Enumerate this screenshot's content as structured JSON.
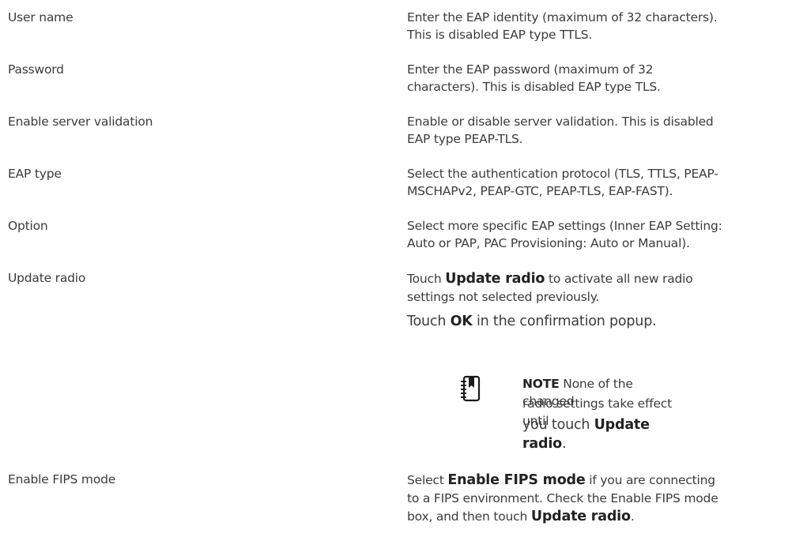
{
  "rows": [
    {
      "label": "User name",
      "desc": [
        "Enter the EAP identity (maximum of 32 characters).",
        "This is disabled EAP type TTLS."
      ]
    },
    {
      "label": "Password",
      "desc": [
        "Enter the EAP password (maximum of 32",
        "characters). This is disabled EAP type TLS."
      ]
    },
    {
      "label": "Enable server validation",
      "desc": [
        "Enable or disable server validation. This is disabled",
        "EAP type PEAP-TLS."
      ]
    },
    {
      "label": "EAP type",
      "desc": [
        "Select the authentication protocol (TLS, TTLS, PEAP-",
        "MSCHAPv2, PEAP-GTC, PEAP-TLS, EAP-FAST)."
      ]
    },
    {
      "label": "Option",
      "desc": [
        "Select more specific EAP settings (Inner EAP Setting:",
        "Auto or PAP, PAC Provisioning: Auto or Manual)."
      ]
    }
  ],
  "update_radio": {
    "label": "Update radio",
    "line1_pre": "Touch ",
    "line1_bold": "Update radio",
    "line1_post": " to activate all new radio",
    "line2": "settings not selected previously.",
    "confirm_pre": "Touch ",
    "confirm_bold": "OK",
    "confirm_post": " in the confirmation popup."
  },
  "note": {
    "icon": "note-book-icon",
    "title": "NOTE",
    "line1_post": "  None of the changed",
    "line2": "radio settings take effect until",
    "line3_pre": "you touch ",
    "line3_bold": "Update radio",
    "line3_post": "."
  },
  "fips": {
    "label": "Enable FIPS mode",
    "l1_pre": "Select ",
    "l1_bold": "Enable FIPS mode",
    "l1_post": " if you are connecting",
    "l2": "to a FIPS environment. Check the Enable FIPS mode",
    "l3_pre": "box, and then touch ",
    "l3_bold": "Update radio",
    "l3_post": "."
  }
}
